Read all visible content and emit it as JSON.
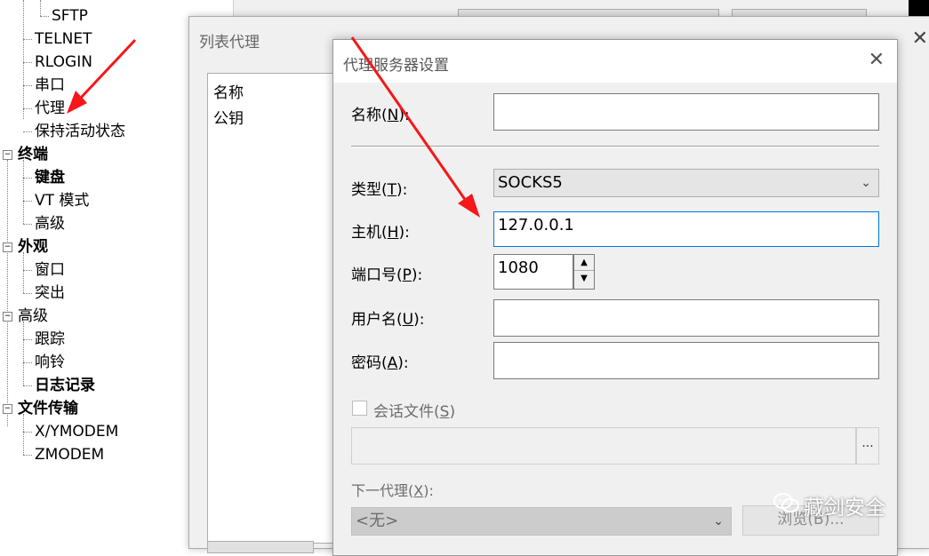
{
  "tree": {
    "items": [
      {
        "label": "SFTP",
        "bold": false
      },
      {
        "label": "TELNET",
        "bold": false
      },
      {
        "label": "RLOGIN",
        "bold": false
      },
      {
        "label": "串口",
        "bold": false
      },
      {
        "label": "代理",
        "bold": false
      },
      {
        "label": "保持活动状态",
        "bold": false
      },
      {
        "label": "终端",
        "bold": true
      },
      {
        "label": "键盘",
        "bold": true
      },
      {
        "label": "VT 模式",
        "bold": false
      },
      {
        "label": "高级",
        "bold": false
      },
      {
        "label": "外观",
        "bold": true
      },
      {
        "label": "窗口",
        "bold": false
      },
      {
        "label": "突出",
        "bold": false
      },
      {
        "label": "高级",
        "bold": false
      },
      {
        "label": "跟踪",
        "bold": false
      },
      {
        "label": "响铃",
        "bold": false
      },
      {
        "label": "日志记录",
        "bold": true
      },
      {
        "label": "文件传输",
        "bold": true
      },
      {
        "label": "X/YMODEM",
        "bold": false
      },
      {
        "label": "ZMODEM",
        "bold": false
      }
    ]
  },
  "list_dialog": {
    "title": "列表代理",
    "close_glyph": "✕",
    "items": [
      "名称",
      "公钥"
    ]
  },
  "proxy_dialog": {
    "title": "代理服务器设置",
    "close_glyph": "✕",
    "name": {
      "label_pre": "名称(",
      "label_key": "N",
      "label_post": "):",
      "value": ""
    },
    "type": {
      "label_pre": "类型(",
      "label_key": "T",
      "label_post": "):",
      "value": "SOCKS5"
    },
    "host": {
      "label_pre": "主机(",
      "label_key": "H",
      "label_post": "):",
      "value": "127.0.0.1"
    },
    "port": {
      "label_pre": "端口号(",
      "label_key": "P",
      "label_post": "):",
      "value": "1080"
    },
    "user": {
      "label_pre": "用户名(",
      "label_key": "U",
      "label_post": "):",
      "value": ""
    },
    "password": {
      "label_pre": "密码(",
      "label_key": "A",
      "label_post": "):",
      "value": ""
    },
    "session_file": {
      "label_pre": "会话文件(",
      "label_key": "S",
      "label_post": ")",
      "checked": false,
      "browse_dots": "..."
    },
    "next_proxy": {
      "label_pre": "下一代理(",
      "label_key": "X",
      "label_post": "):",
      "value": "<无>"
    },
    "browse_button": "浏览(B)..."
  },
  "watermark": {
    "text": "藏剑安全"
  },
  "colors": {
    "arrow": "#f5171a",
    "focus_border": "#0078d7"
  }
}
